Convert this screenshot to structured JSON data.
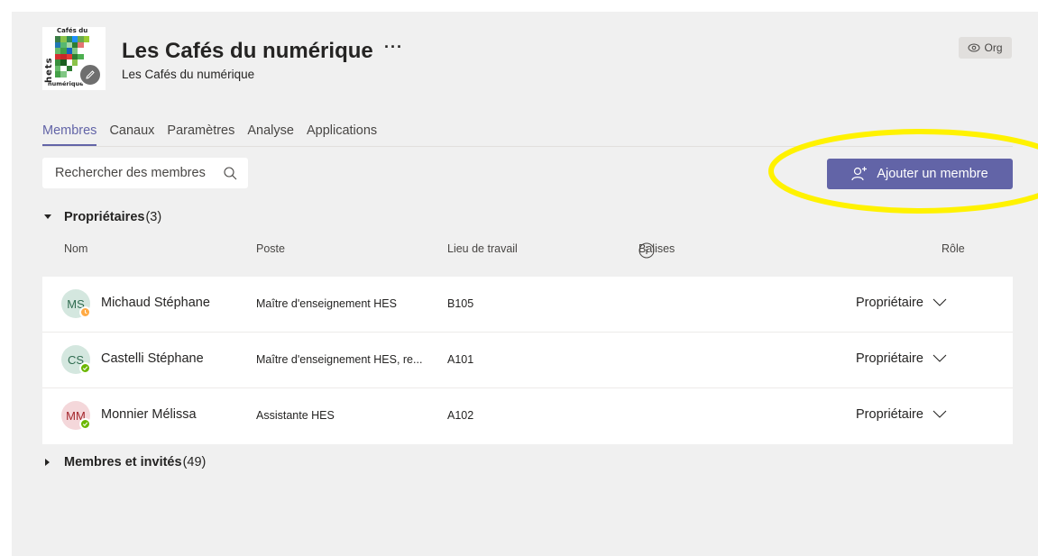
{
  "team": {
    "title": "Les Cafés du numérique",
    "more": "···",
    "subtitle": "Les Cafés du numérique",
    "org_label": "Org",
    "logo": {
      "top_text": "Cafés du",
      "side_text": "hets",
      "bottom_text": "numérique"
    }
  },
  "tabs": [
    {
      "label": "Membres",
      "active": true
    },
    {
      "label": "Canaux"
    },
    {
      "label": "Paramètres"
    },
    {
      "label": "Analyse"
    },
    {
      "label": "Applications"
    }
  ],
  "search": {
    "placeholder": "Rechercher des membres"
  },
  "add_member": {
    "label": "Ajouter un membre"
  },
  "owners_section": {
    "title": "Propriétaires",
    "count": "(3)"
  },
  "members_section": {
    "title": "Membres et invités",
    "count": "(49)"
  },
  "columns": {
    "name": "Nom",
    "poste": "Poste",
    "lieu": "Lieu de travail",
    "balises": "Balises",
    "role": "Rôle"
  },
  "owners": [
    {
      "initials": "MS",
      "name": "Michaud Stéphane",
      "poste": "Maître d'enseignement HES",
      "lieu": "B105",
      "role": "Propriétaire",
      "avatar_bg": "#d4e7df",
      "avatar_fg": "#2e6b4f",
      "status": "away",
      "status_color": "#ffaa44"
    },
    {
      "initials": "CS",
      "name": "Castelli Stéphane",
      "poste": "Maître d'enseignement HES, re...",
      "lieu": "A101",
      "role": "Propriétaire",
      "avatar_bg": "#d4e7df",
      "avatar_fg": "#2e6b4f",
      "status": "available",
      "status_color": "#6bb700"
    },
    {
      "initials": "MM",
      "name": "Monnier Mélissa",
      "poste": "Assistante HES",
      "lieu": "A102",
      "role": "Propriétaire",
      "avatar_bg": "#f4d7da",
      "avatar_fg": "#a4262c",
      "status": "available",
      "status_color": "#6bb700"
    }
  ],
  "colors": {
    "accent": "#6264a7",
    "highlight": "#fff200"
  }
}
